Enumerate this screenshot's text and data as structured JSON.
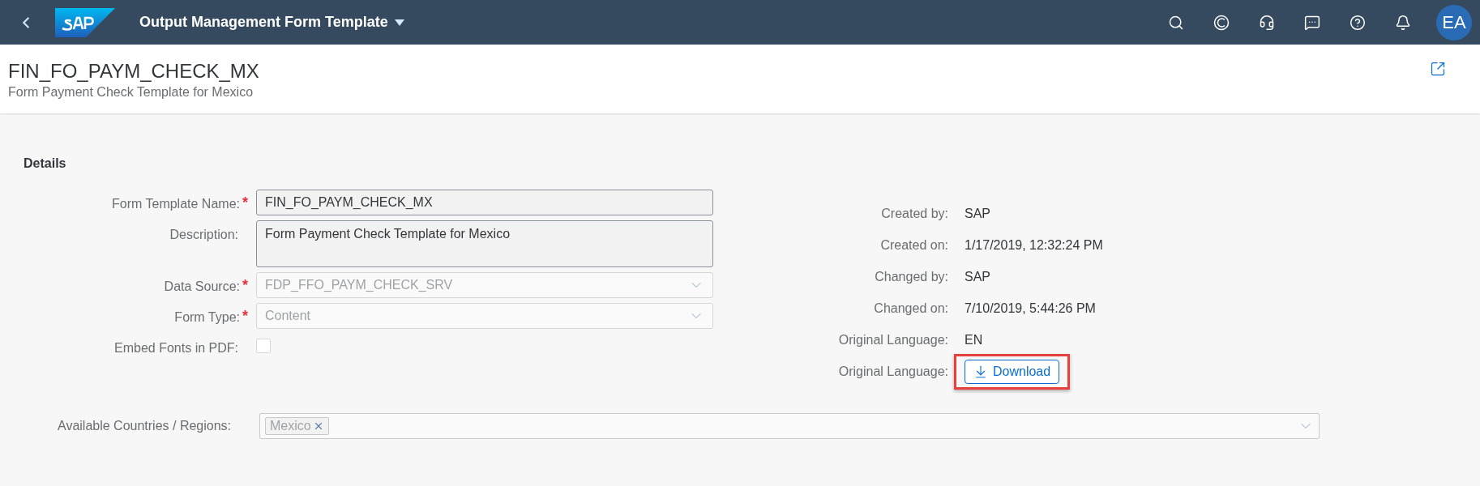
{
  "shell": {
    "app_title": "Output Management Form Template",
    "avatar_initials": "EA"
  },
  "page": {
    "title": "FIN_FO_PAYM_CHECK_MX",
    "subtitle": "Form Payment Check Template for Mexico"
  },
  "details": {
    "heading": "Details",
    "fields": [
      {
        "kind": "input",
        "label": "Form Template Name:",
        "required_mark": "*",
        "value": "FIN_FO_PAYM_CHECK_MX"
      },
      {
        "kind": "textarea",
        "label": "Description:",
        "value": "Form Payment Check Template for Mexico"
      },
      {
        "kind": "select",
        "label": "Data Source:",
        "required_mark": "*",
        "value": "FDP_FFO_PAYM_CHECK_SRV",
        "disabled": true
      },
      {
        "kind": "select",
        "label": "Form Type:",
        "required_mark": "*",
        "value": "Content",
        "disabled": true
      },
      {
        "kind": "checkbox",
        "label": "Embed Fonts in PDF:",
        "checked": false
      }
    ]
  },
  "admin": [
    {
      "kind": "text",
      "label": "Created by:",
      "value": "SAP"
    },
    {
      "kind": "text",
      "label": "Created on:",
      "value": "1/17/2019, 12:32:24 PM"
    },
    {
      "kind": "text",
      "label": "Changed by:",
      "value": "SAP"
    },
    {
      "kind": "text",
      "label": "Changed on:",
      "value": "7/10/2019, 5:44:26 PM"
    },
    {
      "kind": "text",
      "label": "Original Language:",
      "value": "EN"
    },
    {
      "kind": "button",
      "label": "Original Language:",
      "value": "Download",
      "highlighted": true
    }
  ],
  "countries": {
    "label": "Available Countries / Regions:",
    "tokens": [
      {
        "text": "Mexico"
      }
    ]
  }
}
